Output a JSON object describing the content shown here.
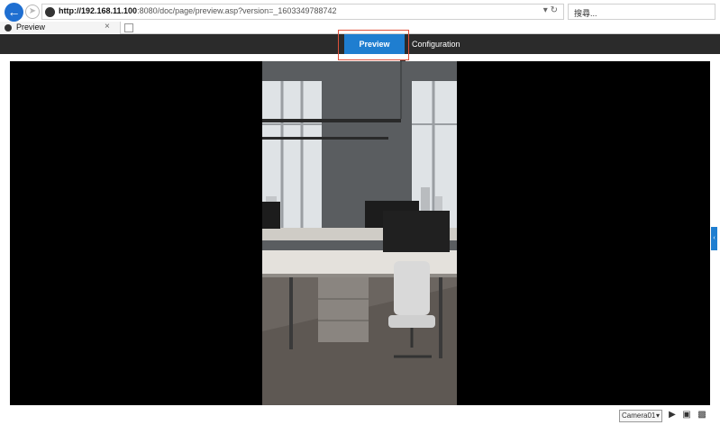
{
  "browser": {
    "back_icon": "back-arrow-icon",
    "forward_icon": "forward-icon",
    "url_host": "http://192.168.11.100",
    "url_rest": ":8080/doc/page/preview.asp?version=_1603349788742",
    "search_placeholder": "搜尋...",
    "tab_title": "Preview",
    "tab_close": "×"
  },
  "nav": {
    "preview_label": "Preview",
    "configuration_label": "Configuration",
    "active_color": "#1f7ed0"
  },
  "controls": {
    "camera_selected": "Camera01",
    "play_icon": "play-icon",
    "snapshot_icon": "camera-icon",
    "record_icon": "video-record-icon"
  }
}
